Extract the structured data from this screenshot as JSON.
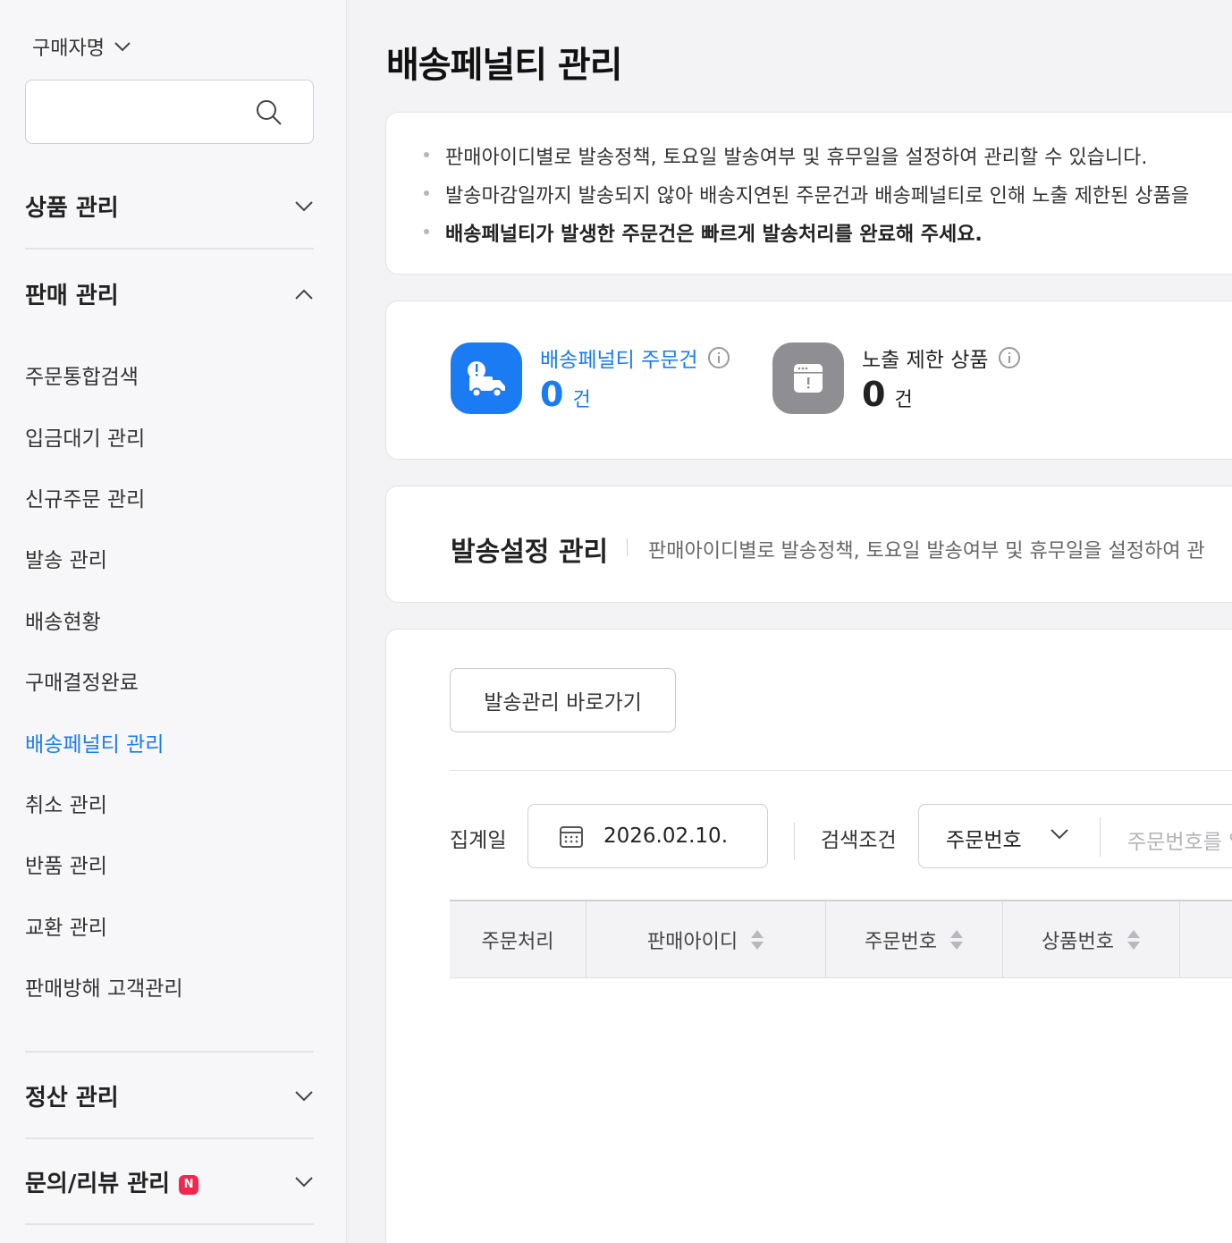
{
  "sidebar": {
    "search_type": "구매자명",
    "search_placeholder": "",
    "sections": [
      {
        "label": "상품 관리",
        "expanded": false
      },
      {
        "label": "판매 관리",
        "expanded": true
      },
      {
        "label": "정산 관리",
        "expanded": false
      },
      {
        "label": "문의/리뷰 관리",
        "expanded": false,
        "badge": "N"
      }
    ],
    "sales_items": [
      "주문통합검색",
      "입금대기 관리",
      "신규주문 관리",
      "발송 관리",
      "배송현황",
      "구매결정완료",
      "배송페널티 관리",
      "취소 관리",
      "반품 관리",
      "교환 관리",
      "판매방해 고객관리"
    ],
    "active_item": "배송페널티 관리"
  },
  "page": {
    "title": "배송페널티 관리"
  },
  "notice": {
    "items": [
      "판매아이디별로 발송정책, 토요일 발송여부 및 휴무일을 설정하여 관리할 수 있습니다.",
      "발송마감일까지 발송되지 않아 배송지연된 주문건과 배송페널티로 인해 노출 제한된 상품을",
      "배송페널티가 발생한 주문건은 빠르게 발송처리를 완료해 주세요."
    ]
  },
  "stats": [
    {
      "label": "배송페널티 주문건",
      "count": "0",
      "unit": "건",
      "icon": "delivery-truck-alert-icon",
      "color": "#1a7bf2"
    },
    {
      "label": "노출 제한 상품",
      "count": "0",
      "unit": "건",
      "icon": "restricted-window-icon",
      "color": "#222222"
    }
  ],
  "shipping_settings": {
    "title": "발송설정 관리",
    "description": "판매아이디별로 발송정책, 토요일 발송여부 및 휴무일을 설정하여 관"
  },
  "filters": {
    "shortcut_button": "발송관리 바로가기",
    "date_label": "집계일",
    "date_value": "2026.02.10.",
    "condition_label": "검색조건",
    "condition_value": "주문번호",
    "condition_placeholder": "주문번호를 입"
  },
  "table": {
    "columns": [
      "주문처리",
      "판매아이디",
      "주문번호",
      "상품번호"
    ]
  },
  "colors": {
    "accent": "#1a7bf2",
    "badge": "#f1274b",
    "muted_icon": "#8e8e93"
  }
}
